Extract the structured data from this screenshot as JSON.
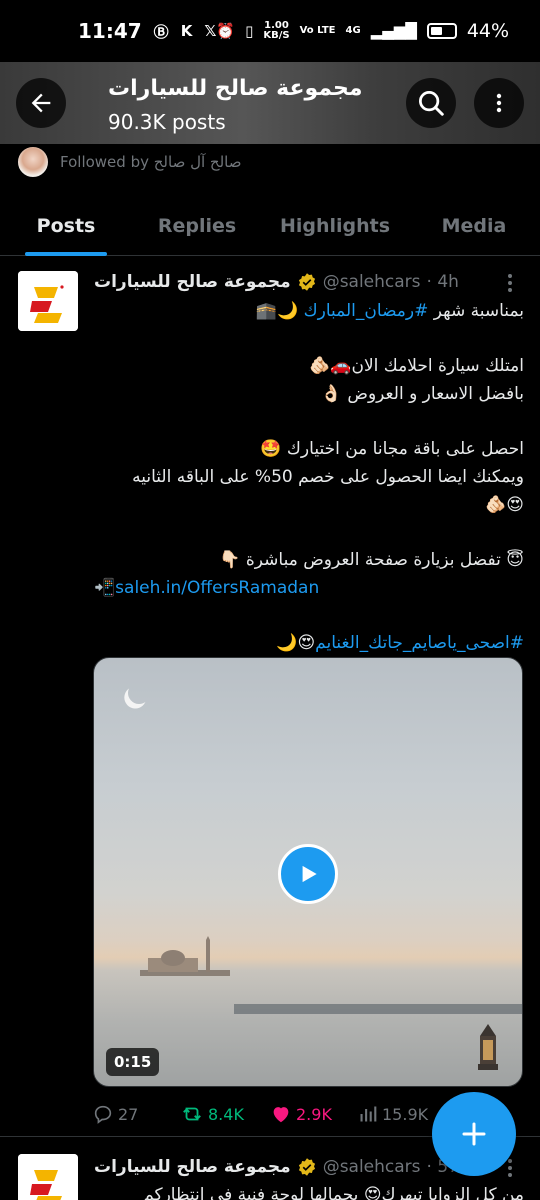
{
  "status_bar": {
    "time": "11:47",
    "net_speed_top": "1.00",
    "net_speed_bottom": "KB/S",
    "volte": "Vo LTE",
    "network": "4G",
    "battery": "44%"
  },
  "header": {
    "title": "مجموعة صالح للسيارات",
    "subtitle": "90.3K posts"
  },
  "followed_by": "Followed by صالح آل صالح",
  "tabs": [
    {
      "label": "Posts",
      "active": true
    },
    {
      "label": "Replies",
      "active": false
    },
    {
      "label": "Highlights",
      "active": false
    },
    {
      "label": "Media",
      "active": false
    }
  ],
  "post": {
    "author_name": "مجموعة صالح للسيارات",
    "handle": "@salehcars",
    "time": "· 4h",
    "lines": {
      "l1_prefix": "بمناسبة شهر ",
      "l1_hashtag": "#رمضان_المبارك",
      "l1_suffix": " 🌙🕋",
      "l2": "امتلك سيارة احلامك الان🚗🫵🏻",
      "l3": "بافضل الاسعار و العروض 👌🏻",
      "l4": "احصل على باقة مجانا من اختيارك 🤩",
      "l5": "ويمكنك ايضا الحصول على خصم 50% على الباقه الثانيه",
      "l6": "😍🫵🏻",
      "l7": "😇 تفضل بزيارة صفحة العروض مباشرة 👇🏻",
      "l8_icon": "📲",
      "l8_url": "saleh.in/OffersRamadan",
      "l9_emoji": "😍🌙 ",
      "l9_hashtag": "#اصحى_ياصايم_جاتك_الغنايم"
    },
    "video_duration": "0:15",
    "stats": {
      "replies": "27",
      "reposts": "8.4K",
      "likes": "2.9K",
      "views": "15.9K"
    }
  },
  "post2": {
    "author_name": "مجموعة صالح للسيارات",
    "handle": "@salehcars",
    "time": "· 57m",
    "text": "من كل الزوايا تبهرك😍 بجمالها لوحة فنية في انتظاركم"
  },
  "colors": {
    "accent": "#1d9bf0",
    "repost": "#00ba7c",
    "like": "#f91880",
    "muted": "#71767b"
  },
  "icons": [
    "back-arrow-icon",
    "search-icon",
    "more-vertical-icon",
    "verified-badge-icon",
    "reply-icon",
    "repost-icon",
    "like-heart-icon",
    "views-icon",
    "share-icon",
    "play-icon",
    "compose-plus-icon"
  ]
}
